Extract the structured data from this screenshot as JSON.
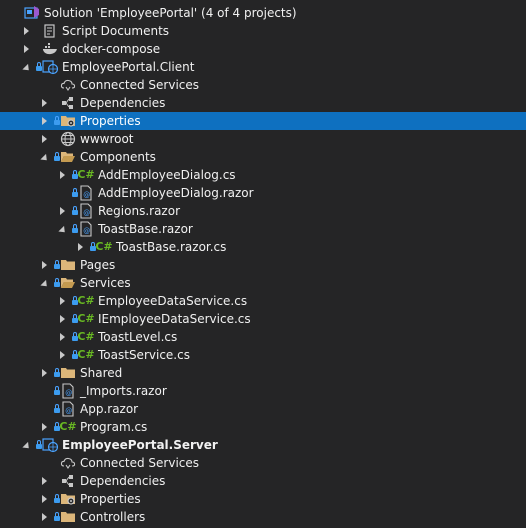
{
  "solution_explorer": {
    "rows": [
      {
        "label": "Solution 'EmployeePortal' (4 of 4 projects)",
        "icon": "solution-icon",
        "level": 0,
        "expander": "none",
        "lock": false
      },
      {
        "label": "Script Documents",
        "icon": "script-documents-icon",
        "level": 1,
        "expander": "collapsed",
        "lock": false
      },
      {
        "label": "docker-compose",
        "icon": "docker-icon",
        "level": 1,
        "expander": "collapsed",
        "lock": false
      },
      {
        "label": "EmployeePortal.Client",
        "icon": "web-project-icon",
        "level": 1,
        "expander": "expanded",
        "lock": true
      },
      {
        "label": "Connected Services",
        "icon": "connected-services-icon",
        "level": 2,
        "expander": "none",
        "lock": false
      },
      {
        "label": "Dependencies",
        "icon": "dependencies-icon",
        "level": 2,
        "expander": "collapsed",
        "lock": false
      },
      {
        "label": "Properties",
        "icon": "properties-folder-icon",
        "level": 2,
        "expander": "collapsed",
        "lock": true,
        "selected": true
      },
      {
        "label": "wwwroot",
        "icon": "globe-icon",
        "level": 2,
        "expander": "collapsed",
        "lock": false
      },
      {
        "label": "Components",
        "icon": "folder-open-icon",
        "level": 2,
        "expander": "expanded",
        "lock": true
      },
      {
        "label": "AddEmployeeDialog.cs",
        "icon": "csharp-file-icon",
        "level": 3,
        "expander": "collapsed",
        "lock": true
      },
      {
        "label": "AddEmployeeDialog.razor",
        "icon": "razor-file-icon",
        "level": 3,
        "expander": "none",
        "lock": true
      },
      {
        "label": "Regions.razor",
        "icon": "razor-file-icon",
        "level": 3,
        "expander": "collapsed",
        "lock": true
      },
      {
        "label": "ToastBase.razor",
        "icon": "razor-file-icon",
        "level": 3,
        "expander": "expanded",
        "lock": true
      },
      {
        "label": "ToastBase.razor.cs",
        "icon": "csharp-file-icon",
        "level": 4,
        "expander": "collapsed",
        "lock": true
      },
      {
        "label": "Pages",
        "icon": "folder-icon",
        "level": 2,
        "expander": "collapsed",
        "lock": true
      },
      {
        "label": "Services",
        "icon": "folder-open-icon",
        "level": 2,
        "expander": "expanded",
        "lock": true
      },
      {
        "label": "EmployeeDataService.cs",
        "icon": "csharp-file-icon",
        "level": 3,
        "expander": "collapsed",
        "lock": true
      },
      {
        "label": "IEmployeeDataService.cs",
        "icon": "csharp-file-icon",
        "level": 3,
        "expander": "collapsed",
        "lock": true
      },
      {
        "label": "ToastLevel.cs",
        "icon": "csharp-file-icon",
        "level": 3,
        "expander": "collapsed",
        "lock": true
      },
      {
        "label": "ToastService.cs",
        "icon": "csharp-file-icon",
        "level": 3,
        "expander": "collapsed",
        "lock": true
      },
      {
        "label": "Shared",
        "icon": "folder-icon",
        "level": 2,
        "expander": "collapsed",
        "lock": true
      },
      {
        "label": "_Imports.razor",
        "icon": "razor-file-icon",
        "level": 2,
        "expander": "none",
        "lock": true
      },
      {
        "label": "App.razor",
        "icon": "razor-file-icon",
        "level": 2,
        "expander": "none",
        "lock": true
      },
      {
        "label": "Program.cs",
        "icon": "csharp-file-icon",
        "level": 2,
        "expander": "collapsed",
        "lock": true
      },
      {
        "label": "EmployeePortal.Server",
        "icon": "web-project-icon",
        "level": 1,
        "expander": "expanded",
        "lock": true,
        "bold": true
      },
      {
        "label": "Connected Services",
        "icon": "connected-services-icon",
        "level": 2,
        "expander": "none",
        "lock": false
      },
      {
        "label": "Dependencies",
        "icon": "dependencies-icon",
        "level": 2,
        "expander": "collapsed",
        "lock": false
      },
      {
        "label": "Properties",
        "icon": "properties-folder-icon",
        "level": 2,
        "expander": "collapsed",
        "lock": true
      },
      {
        "label": "Controllers",
        "icon": "folder-icon",
        "level": 2,
        "expander": "collapsed",
        "lock": true
      }
    ]
  },
  "colors": {
    "background": "#252526",
    "selection": "#0e70c0",
    "text": "#f1f1f1",
    "folder": "#dcb67a",
    "csharp": "#68b723",
    "lock": "#3c9cf0"
  }
}
